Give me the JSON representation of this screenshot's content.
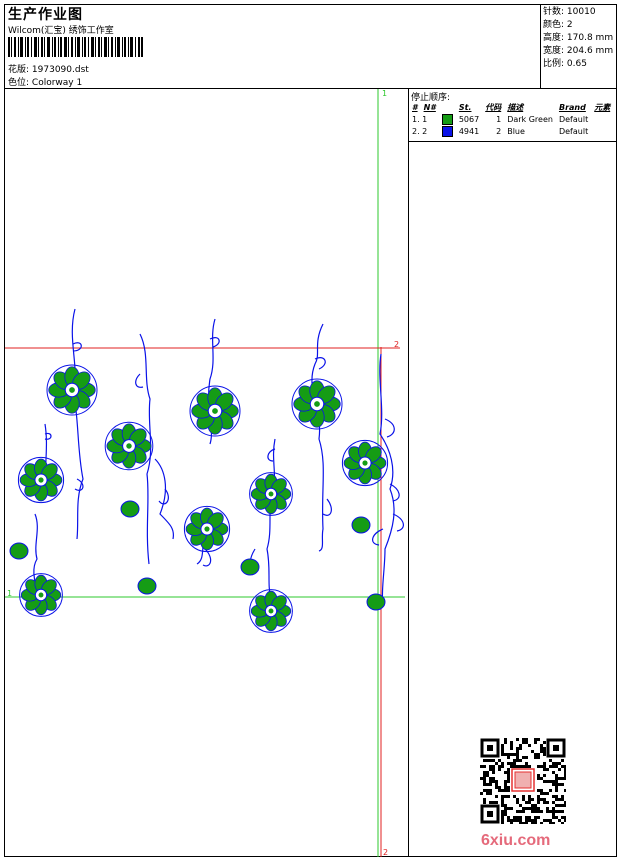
{
  "header": {
    "title": "生产作业图",
    "company": "Wilcom(汇宝) 绣饰工作室",
    "design_label": "花版:",
    "design_value": "1973090.dst",
    "colorway_label": "色位:",
    "colorway_value": "Colorway 1"
  },
  "stats": [
    {
      "label": "针数:",
      "value": "10010"
    },
    {
      "label": "颜色:",
      "value": "2"
    },
    {
      "label": "高度:",
      "value": "170.8 mm"
    },
    {
      "label": "宽度:",
      "value": "204.6 mm"
    },
    {
      "label": "比例:",
      "value": "0.65"
    }
  ],
  "stop_sequence": {
    "title": "停止顺序:",
    "columns": [
      "#",
      "N#",
      "St.",
      "代码",
      "描述",
      "Brand",
      "元素"
    ],
    "rows": [
      {
        "index": "1. 1",
        "code": "5067",
        "stops": "1",
        "name": "Dark Green",
        "brand": "Default",
        "color": "#159c15"
      },
      {
        "index": "2. 2",
        "code": "4941",
        "stops": "2",
        "name": "Blue",
        "brand": "Default",
        "color": "#0a12e8"
      }
    ]
  },
  "guides": {
    "top_v": "1",
    "left_h": "1",
    "right_h": "2",
    "bottom_v": "2"
  },
  "colors": {
    "green": "#159c15",
    "blue": "#0a12e8",
    "guide_green": "#2ec82e",
    "guide_red": "#e02020"
  },
  "watermark": "6xiu.com"
}
